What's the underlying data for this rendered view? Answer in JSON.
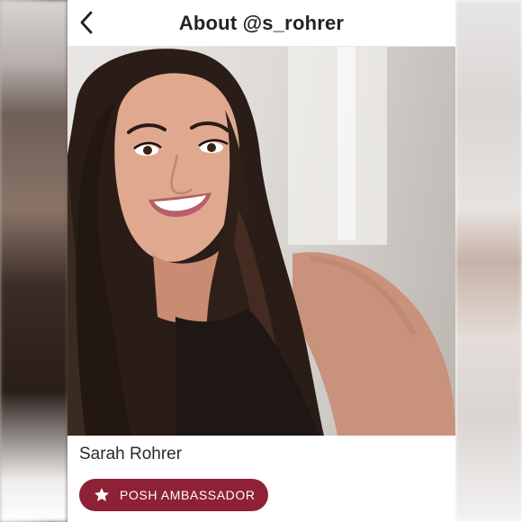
{
  "header": {
    "title": "About @s_rohrer",
    "back_icon": "chevron-left-icon"
  },
  "profile": {
    "name": "Sarah Rohrer",
    "photo_icon": "profile-photo"
  },
  "badge": {
    "label": "POSH AMBASSADOR",
    "icon": "star-icon",
    "color": "#8e2135"
  },
  "colors": {
    "background": "#ffffff",
    "text": "#222222",
    "accent": "#8e2135"
  }
}
